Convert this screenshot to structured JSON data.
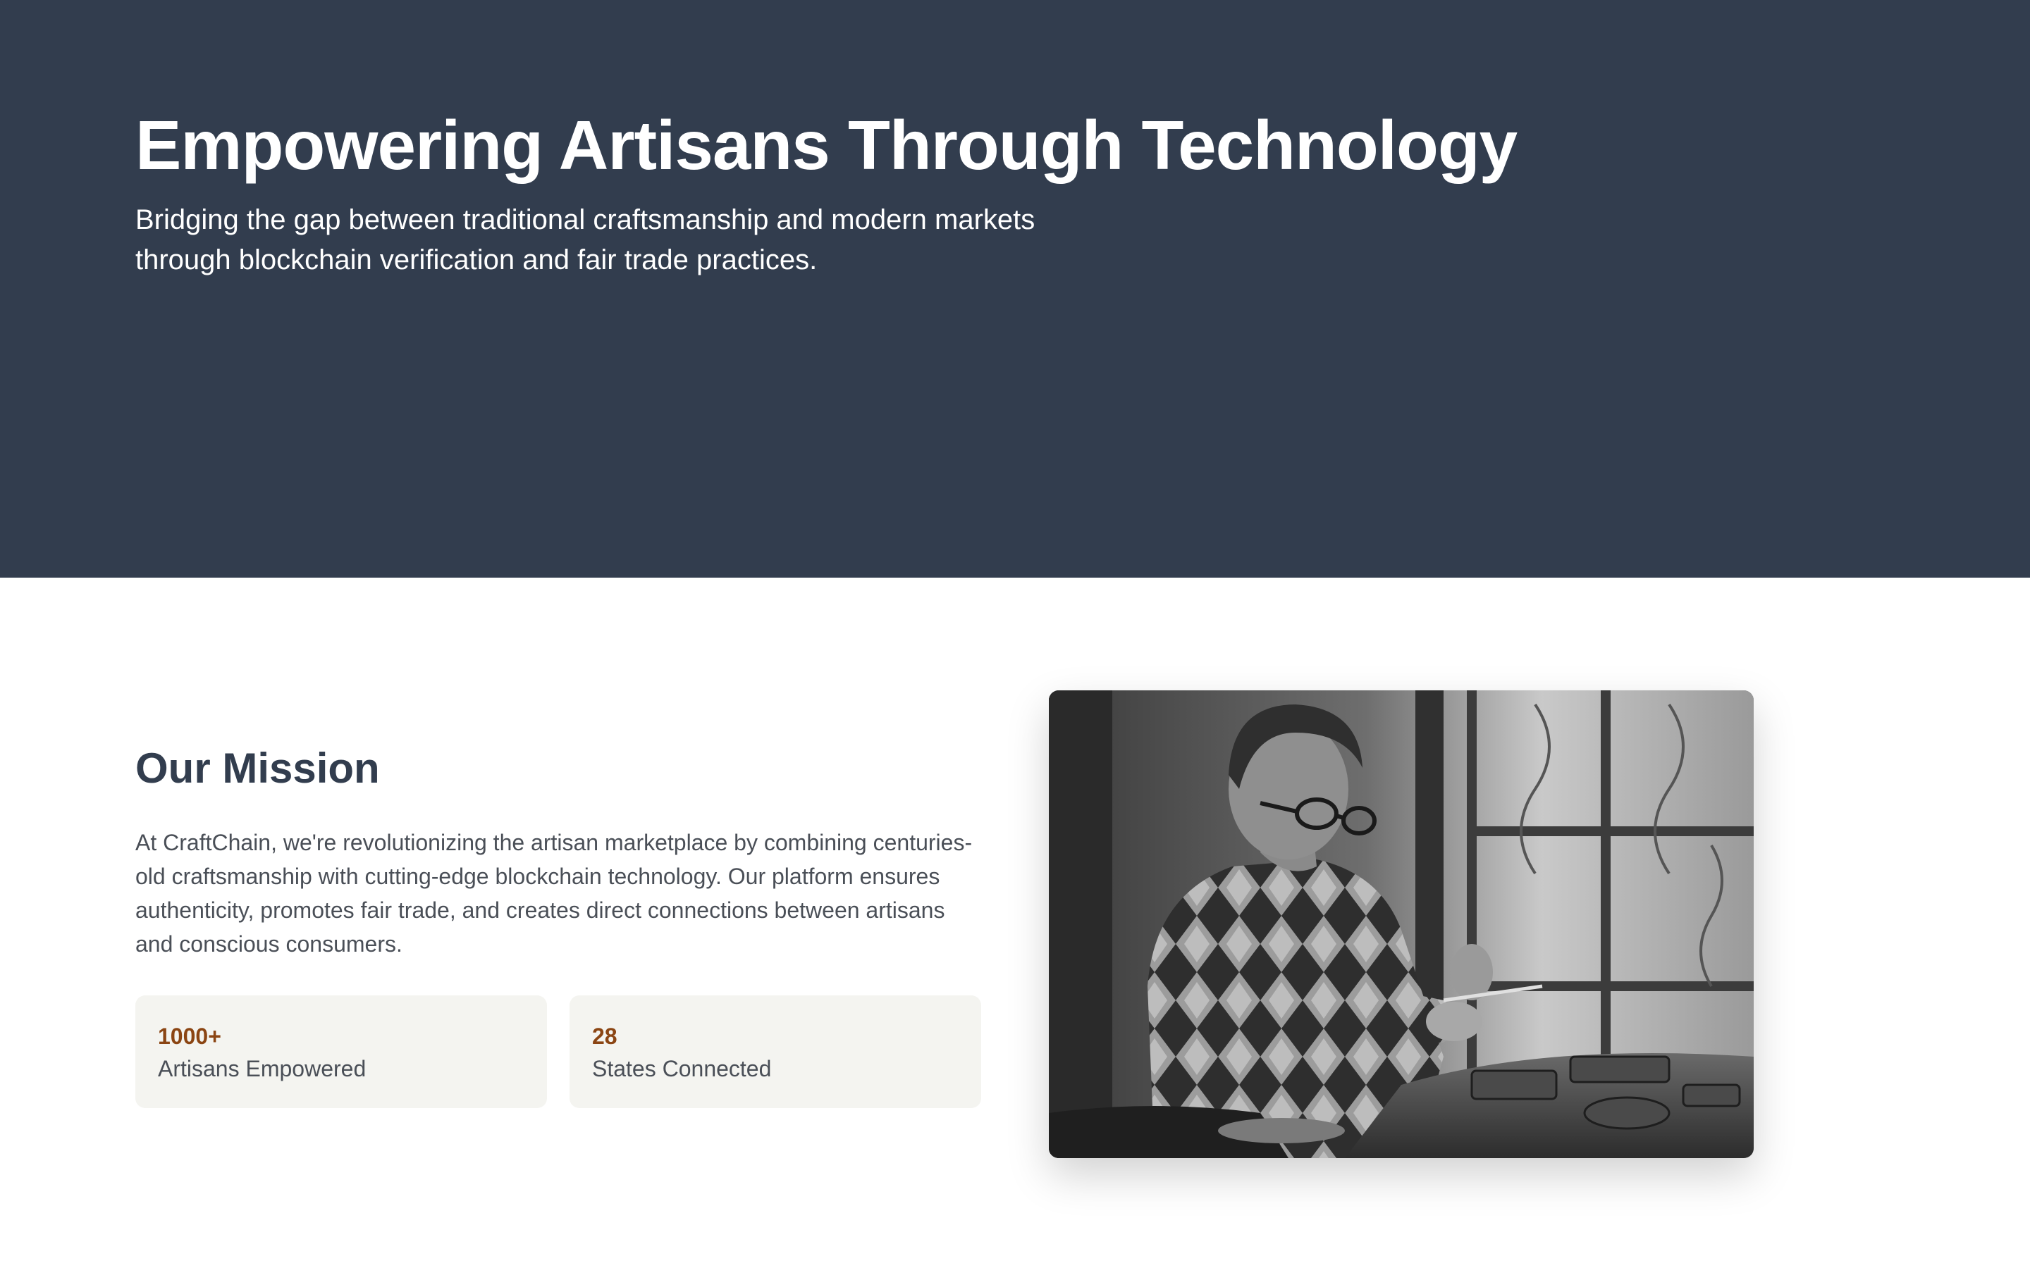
{
  "hero": {
    "title": "Empowering Artisans Through Technology",
    "subtitle": "Bridging the gap between traditional craftsmanship and modern markets through blockchain verification and fair trade practices."
  },
  "mission": {
    "heading": "Our Mission",
    "body": "At CraftChain, we're revolutionizing the artisan marketplace by combining centuries-old craftsmanship with cutting-edge blockchain technology. Our platform ensures authenticity, promotes fair trade, and creates direct connections between artisans and conscious consumers.",
    "stats": [
      {
        "value": "1000+",
        "label": "Artisans Empowered"
      },
      {
        "value": "28",
        "label": "States Connected"
      }
    ],
    "image": {
      "icon": "artisan-photo",
      "tone": "black-and-white"
    }
  },
  "colors": {
    "hero_bg": "#323d4e",
    "heading": "#323d4e",
    "accent": "#8b4513",
    "card_bg": "#f4f4f0"
  }
}
